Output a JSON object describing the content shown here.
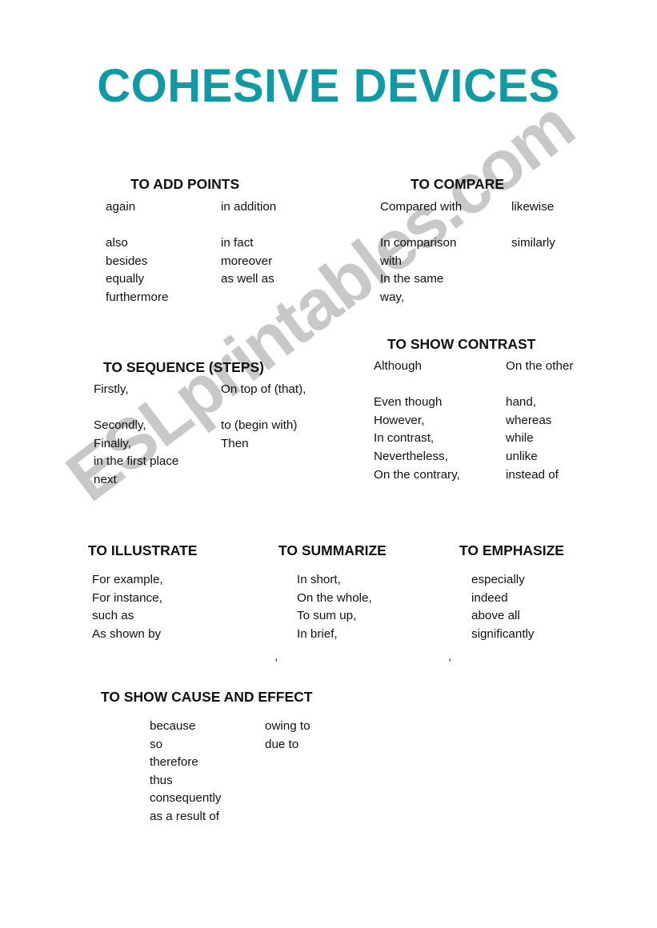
{
  "document": {
    "title": "COHESIVE DEVICES",
    "title_color": "#109aa4",
    "background_color": "#ffffff",
    "text_color": "#111111"
  },
  "watermark": {
    "text": "ESLprintables.com",
    "color": "#c6c6c6",
    "rotation_deg": -37
  },
  "sections": [
    {
      "id": "add-points",
      "title": "TO ADD POINTS",
      "columns": [
        {
          "items": [
            "again",
            "",
            "also",
            "besides",
            "equally",
            "furthermore"
          ]
        },
        {
          "items": [
            "in addition",
            "",
            "in fact",
            "moreover",
            "as well as"
          ]
        }
      ]
    },
    {
      "id": "compare",
      "title": "TO COMPARE",
      "columns": [
        {
          "items": [
            "Compared with",
            "",
            "In comparison",
            "with",
            "In the same",
            "way,"
          ]
        },
        {
          "items": [
            "likewise",
            "",
            "similarly"
          ]
        }
      ]
    },
    {
      "id": "sequence",
      "title": "TO SEQUENCE (STEPS)",
      "columns": [
        {
          "items": [
            "Firstly,",
            "",
            "Secondly,",
            "Finally,",
            "in the first place",
            "next"
          ]
        },
        {
          "items": [
            "On top of (that),",
            "",
            "to (begin with)",
            "Then"
          ]
        }
      ]
    },
    {
      "id": "contrast",
      "title": "TO SHOW CONTRAST",
      "columns": [
        {
          "items": [
            "Although",
            "",
            "Even though",
            "However,",
            "In contrast,",
            "Nevertheless,",
            "On the contrary,"
          ]
        },
        {
          "items": [
            "On the other",
            "",
            "hand,",
            "whereas",
            "while",
            "unlike",
            "instead of"
          ]
        }
      ]
    },
    {
      "id": "illustrate",
      "title": "TO ILLUSTRATE",
      "columns": [
        {
          "items": [
            "For example,",
            "For instance,",
            "such as",
            "As shown by"
          ]
        }
      ]
    },
    {
      "id": "summarize",
      "title": "TO SUMMARIZE",
      "columns": [
        {
          "items": [
            "In short,",
            "On the whole,",
            "To sum up,",
            "In brief,"
          ]
        }
      ]
    },
    {
      "id": "emphasize",
      "title": "TO EMPHASIZE",
      "columns": [
        {
          "items": [
            "especially",
            "indeed",
            "above all",
            "significantly"
          ]
        }
      ]
    },
    {
      "id": "cause-effect",
      "title": "TO SHOW CAUSE AND EFFECT",
      "columns": [
        {
          "items": [
            "because",
            "so",
            "therefore",
            "thus",
            "consequently",
            "as a result of"
          ]
        },
        {
          "items": [
            "owing to",
            "due to"
          ]
        }
      ]
    }
  ],
  "stray_marks": [
    {
      "text": ",",
      "id": "stray-comma-1"
    },
    {
      "text": ",",
      "id": "stray-comma-2"
    }
  ]
}
